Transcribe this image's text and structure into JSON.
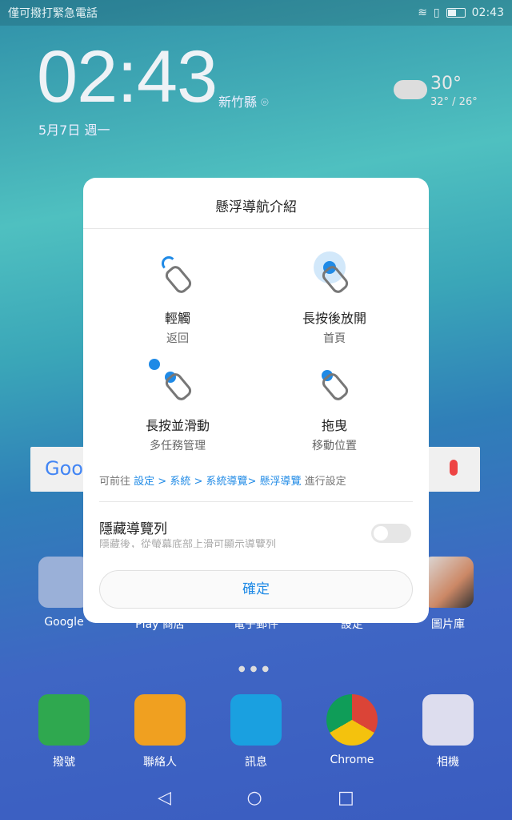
{
  "status": {
    "left_text": "僅可撥打緊急電話",
    "time": "02:43"
  },
  "lock": {
    "clock": "02:43",
    "location": "新竹縣",
    "date": "5月7日 週一",
    "temp": "30°",
    "range": "32° / 26°"
  },
  "search": {
    "logo": "Goo"
  },
  "apps": [
    {
      "label": "Google"
    },
    {
      "label": "Play 商店"
    },
    {
      "label": "電子郵件"
    },
    {
      "label": "設定"
    },
    {
      "label": "圖片庫"
    }
  ],
  "dock": [
    {
      "label": "撥號",
      "color": "#2fa84f"
    },
    {
      "label": "聯絡人",
      "color": "#f0a020"
    },
    {
      "label": "訊息",
      "color": "#1aa0e0"
    },
    {
      "label": "Chrome",
      "color": "#db4437"
    },
    {
      "label": "相機",
      "color": "#dde"
    }
  ],
  "dialog": {
    "title": "懸浮導航介紹",
    "gestures": [
      {
        "title": "輕觸",
        "sub": "返回"
      },
      {
        "title": "長按後放開",
        "sub": "首頁"
      },
      {
        "title": "長按並滑動",
        "sub": "多任務管理"
      },
      {
        "title": "拖曳",
        "sub": "移動位置"
      }
    ],
    "hint_prefix": "可前往",
    "hint_path": "設定 > 系統 > 系統導覽> 懸浮導覽",
    "hint_suffix": "進行設定",
    "hide_title": "隱藏導覽列",
    "hide_sub": "隱藏後，從螢幕底部上滑可顯示導覽列",
    "hide_enabled": false,
    "ok": "確定"
  },
  "accent": "#1f8ae6"
}
